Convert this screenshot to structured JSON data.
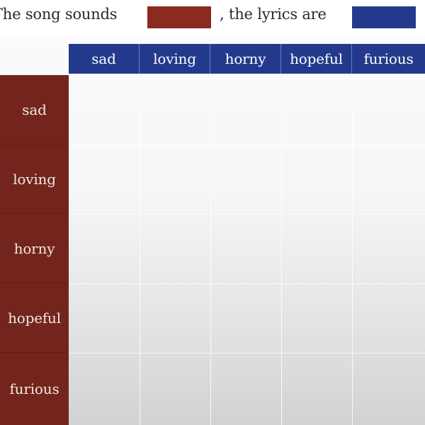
{
  "caption": {
    "part1": "The song sounds",
    "part2": ", the lyrics are",
    "sound_color": "#8b2a20",
    "lyrics_color": "#233a8c"
  },
  "columns": {
    "color": "#233a8c",
    "labels": [
      "sad",
      "loving",
      "horny",
      "hopeful",
      "furious"
    ]
  },
  "rows": {
    "color": "#73251d",
    "labels": [
      "sad",
      "loving",
      "horny",
      "hopeful",
      "furious"
    ]
  }
}
